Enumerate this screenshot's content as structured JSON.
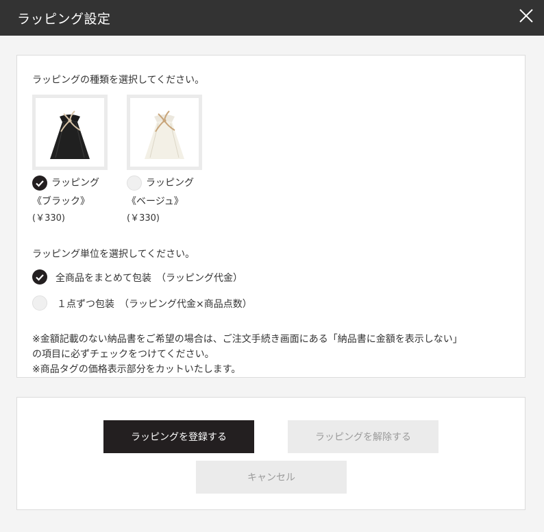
{
  "dialog": {
    "title": "ラッピング設定",
    "close_icon": "close-icon"
  },
  "wrapping_type": {
    "prompt": "ラッピングの種類を選択してください。",
    "options": [
      {
        "name_line1": "ラッピング",
        "name_line2": "《ブラック》",
        "price": "(￥330)",
        "selected": true,
        "image": "black-gift-bag-image"
      },
      {
        "name_line1": "ラッピング",
        "name_line2": "《ベージュ》",
        "price": "(￥330)",
        "selected": false,
        "image": "beige-gift-bag-image"
      }
    ]
  },
  "wrapping_unit": {
    "prompt": "ラッピング単位を選択してください。",
    "options": [
      {
        "label": "全商品をまとめて包装　（ラッピング代金）",
        "selected": true
      },
      {
        "label": "１点ずつ包装　（ラッピング代金×商品点数）",
        "selected": false
      }
    ]
  },
  "notes": [
    "※金額記載のない納品書をご希望の場合は、ご注文手続き画面にある「納品書に金額を表示しない」",
    "の項目に必ずチェックをつけてください。",
    "※商品タグの価格表示部分をカットいたします。"
  ],
  "actions": {
    "register_label": "ラッピングを登録する",
    "remove_label": "ラッピングを解除する",
    "cancel_label": "キャンセル"
  },
  "colors": {
    "header_bg": "#333333",
    "primary_button": "#231f20",
    "disabled_button": "#ebebeb"
  }
}
